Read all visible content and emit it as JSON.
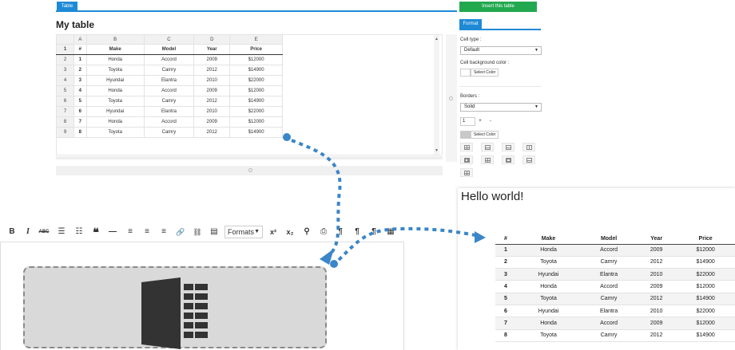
{
  "top_tab": "Table",
  "title": "My table",
  "sheet": {
    "col_letters": [
      "",
      "A",
      "B",
      "C",
      "D",
      "E"
    ],
    "headers": [
      "#",
      "Make",
      "Model",
      "Year",
      "Price"
    ],
    "rows": [
      [
        "1",
        "Honda",
        "Accord",
        "2009",
        "$12000"
      ],
      [
        "2",
        "Toyota",
        "Camry",
        "2012",
        "$14900"
      ],
      [
        "3",
        "Hyundai",
        "Elantra",
        "2010",
        "$22000"
      ],
      [
        "4",
        "Honda",
        "Accord",
        "2009",
        "$12000"
      ],
      [
        "5",
        "Toyota",
        "Camry",
        "2012",
        "$14900"
      ],
      [
        "6",
        "Hyundai",
        "Elantra",
        "2010",
        "$22000"
      ],
      [
        "7",
        "Honda",
        "Accord",
        "2009",
        "$12000"
      ],
      [
        "8",
        "Toyota",
        "Camry",
        "2012",
        "$14900"
      ]
    ],
    "row_numbers": [
      "1",
      "2",
      "3",
      "4",
      "5",
      "6",
      "7",
      "8",
      "9"
    ]
  },
  "right_panel": {
    "insert_button": "Insert this table",
    "format_tab": "Format",
    "cell_type_label": "Cell type :",
    "cell_type_value": "Default",
    "cell_bg_label": "Cell background color :",
    "select_color": "Select Color",
    "borders_label": "Borders :",
    "border_style": "Solid",
    "border_width": "1",
    "plus": "+",
    "minus": "-",
    "swatch_border_color": "#c8c8c8"
  },
  "editor": {
    "toolbar": {
      "bold": "B",
      "italic": "I",
      "strike": "ABC",
      "bullet_list": "☰",
      "numbered_list": "☷",
      "blockquote": "❝",
      "hr": "—",
      "align_left": "≡",
      "align_center": "≡",
      "align_right": "≡",
      "link": "🔗",
      "unlink": "⛓",
      "table": "▤",
      "formats": "Formats",
      "superscript": "x²",
      "subscript": "x₂",
      "find": "⚲",
      "print": "⎙",
      "paragraph": "¶",
      "ltr": "¶",
      "rtl": "¶",
      "table2": "▦"
    }
  },
  "preview": {
    "hello": "Hello world!",
    "headers": [
      "#",
      "Make",
      "Model",
      "Year",
      "Price"
    ],
    "rows": [
      [
        "1",
        "Honda",
        "Accord",
        "2009",
        "$12000"
      ],
      [
        "2",
        "Toyota",
        "Camry",
        "2012",
        "$14900"
      ],
      [
        "3",
        "Hyundai",
        "Elantra",
        "2010",
        "$22000"
      ],
      [
        "4",
        "Honda",
        "Accord",
        "2009",
        "$12000"
      ],
      [
        "5",
        "Toyota",
        "Camry",
        "2012",
        "$14900"
      ],
      [
        "6",
        "Hyundai",
        "Elantra",
        "2010",
        "$22000"
      ],
      [
        "7",
        "Honda",
        "Accord",
        "2009",
        "$12000"
      ],
      [
        "8",
        "Toyota",
        "Camry",
        "2012",
        "$14900"
      ]
    ]
  },
  "colors": {
    "accent": "#1e8ad6",
    "insert_green": "#22a94f",
    "arrow_blue": "#3a86c8"
  }
}
